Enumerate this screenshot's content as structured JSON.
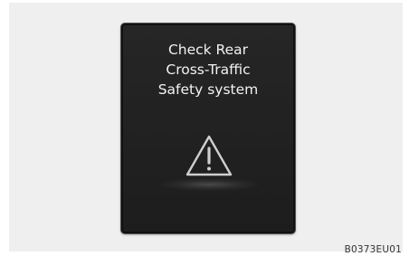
{
  "panel": {
    "message_lines": [
      "Check Rear",
      "Cross-Traffic",
      "Safety system"
    ],
    "icon": "warning-triangle-icon"
  },
  "figure": {
    "code": "B0373EU01"
  },
  "colors": {
    "page_background": "#ffffff",
    "figure_background": "#efefef",
    "panel_background": "#232323",
    "text": "#f2f2f2",
    "icon_stroke": "#cfcfcf"
  }
}
